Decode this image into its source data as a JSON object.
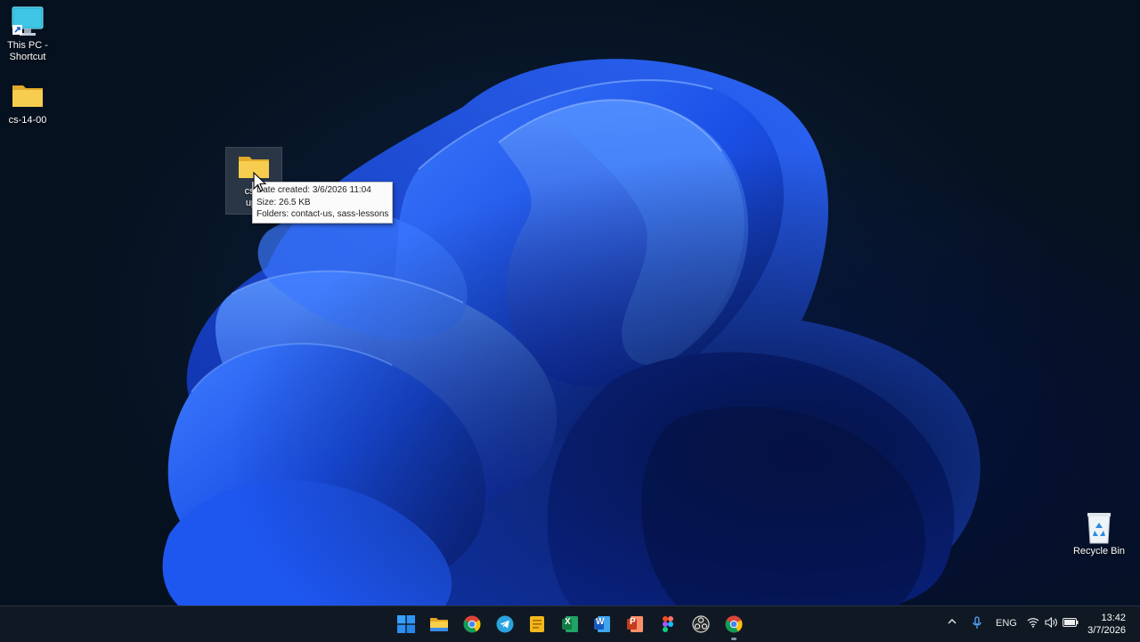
{
  "desktop": {
    "icons": [
      {
        "label_line1": "This PC -",
        "label_line2": "Shortcut",
        "icon": "monitor-shortcut-icon"
      },
      {
        "label": "cs-14-00",
        "icon": "folder-icon"
      },
      {
        "label_line1": "cs-1",
        "label_line2": "upd",
        "icon": "folder-icon"
      },
      {
        "label": "Recycle Bin",
        "icon": "recycle-bin-icon"
      }
    ]
  },
  "tooltip": {
    "line1": "Date created: 3/6/2026 11:04",
    "line2": "Size: 26.5 KB",
    "line3": "Folders: contact-us, sass-lessons"
  },
  "taskbar": {
    "apps": [
      {
        "name": "start",
        "icon": "windows-start-icon"
      },
      {
        "name": "file-explorer",
        "icon": "file-explorer-icon"
      },
      {
        "name": "chrome",
        "icon": "chrome-icon"
      },
      {
        "name": "telegram",
        "icon": "telegram-icon"
      },
      {
        "name": "notes",
        "icon": "notes-icon"
      },
      {
        "name": "excel",
        "icon": "excel-icon",
        "letter": "X"
      },
      {
        "name": "word",
        "icon": "word-icon",
        "letter": "W"
      },
      {
        "name": "powerpoint",
        "icon": "powerpoint-icon",
        "letter": "P"
      },
      {
        "name": "figma",
        "icon": "figma-icon"
      },
      {
        "name": "obs",
        "icon": "obs-icon"
      },
      {
        "name": "chrome-active",
        "icon": "chrome-icon"
      }
    ],
    "tray": {
      "language": "ENG",
      "time": "13:42",
      "date": "3/7/2026"
    }
  },
  "colors": {
    "accent": "#1f5fff",
    "taskbar_bg": "#101923",
    "folder": "#f6c945"
  }
}
